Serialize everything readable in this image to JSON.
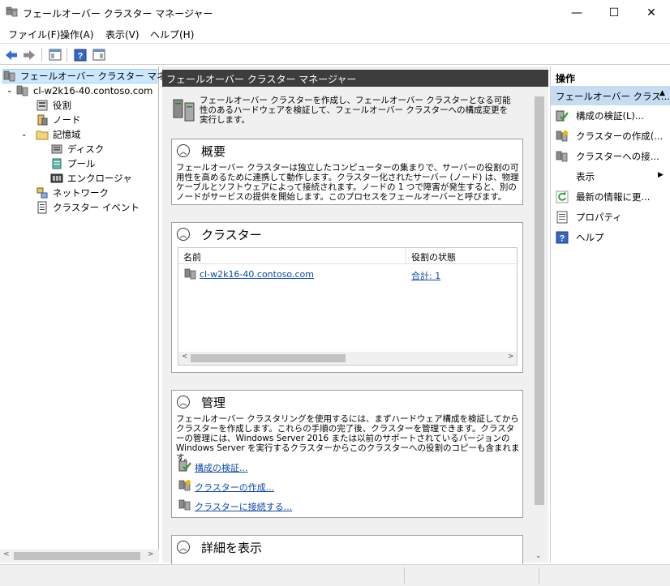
{
  "window": {
    "title": "フェールオーバー クラスター マネージャー",
    "minimize": "—",
    "maximize": "☐",
    "close": "✕"
  },
  "menu": [
    "ファイル(F)",
    "操作(A)",
    "表示(V)",
    "ヘルプ(H)"
  ],
  "toolbar": {
    "back_icon": "back-arrow-icon",
    "forward_icon": "forward-arrow-icon",
    "help_glyph": "?"
  },
  "tree": {
    "root": "フェールオーバー クラスター マネージャー",
    "cluster": "cl-w2k16-40.contoso.com",
    "roles": "役割",
    "nodes": "ノード",
    "storage": "記憶域",
    "disks": "ディスク",
    "pools": "プール",
    "enclosures": "エンクロージャ",
    "networks": "ネットワーク",
    "cluster_events": "クラスター イベント"
  },
  "center": {
    "header": "フェールオーバー クラスター マネージャー",
    "intro": "フェールオーバー クラスターを作成し、フェールオーバー クラスターとなる可能性のあるハードウェアを検証して、フェールオーバー クラスターへの構成変更を実行します。",
    "overview": {
      "title": "概要",
      "text": "フェールオーバー クラスターは独立したコンピューターの集まりで、サーバーの役割の可用性を高めるために連携して動作します。クラスター化されたサーバー (ノード) は、物理ケーブルとソフトウェアによって接続されます。ノードの 1 つで障害が発生すると、別のノードがサービスの提供を開始します。このプロセスをフェールオーバーと呼びます。"
    },
    "clusters": {
      "title": "クラスター",
      "col_name": "名前",
      "col_status": "役割の状態",
      "rows": [
        {
          "name": "cl-w2k16-40.contoso.com",
          "status": "合計: 1"
        }
      ]
    },
    "management": {
      "title": "管理",
      "text": "フェールオーバー クラスタリングを使用するには、まずハードウェア構成を検証してからクラスターを作成します。これらの手順の完了後、クラスターを管理できます。クラスターの管理には、Windows Server 2016 または以前のサポートされているバージョンの Windows Server を実行するクラスターからこのクラスターへの役割のコピーも含まれます。",
      "links": [
        "構成の検証...",
        "クラスターの作成...",
        "クラスターに接続する..."
      ]
    },
    "more": {
      "title": "詳細を表示"
    }
  },
  "actions": {
    "header": "操作",
    "section": "フェールオーバー クラス...",
    "items": [
      {
        "label": "構成の検証(L)...",
        "icon": "validate-icon"
      },
      {
        "label": "クラスターの作成(...",
        "icon": "create-cluster-icon"
      },
      {
        "label": "クラスターへの接...",
        "icon": "connect-cluster-icon"
      },
      {
        "label": "表示",
        "icon": "none"
      },
      {
        "label": "最新の情報に更...",
        "icon": "refresh-icon"
      },
      {
        "label": "プロパティ",
        "icon": "properties-icon"
      },
      {
        "label": "ヘルプ",
        "icon": "help-icon"
      }
    ]
  },
  "colors": {
    "accent": "#0078d7",
    "header_dark": "#3d3d3d",
    "selection": "#cce8ff",
    "link": "#0b4aa8"
  }
}
